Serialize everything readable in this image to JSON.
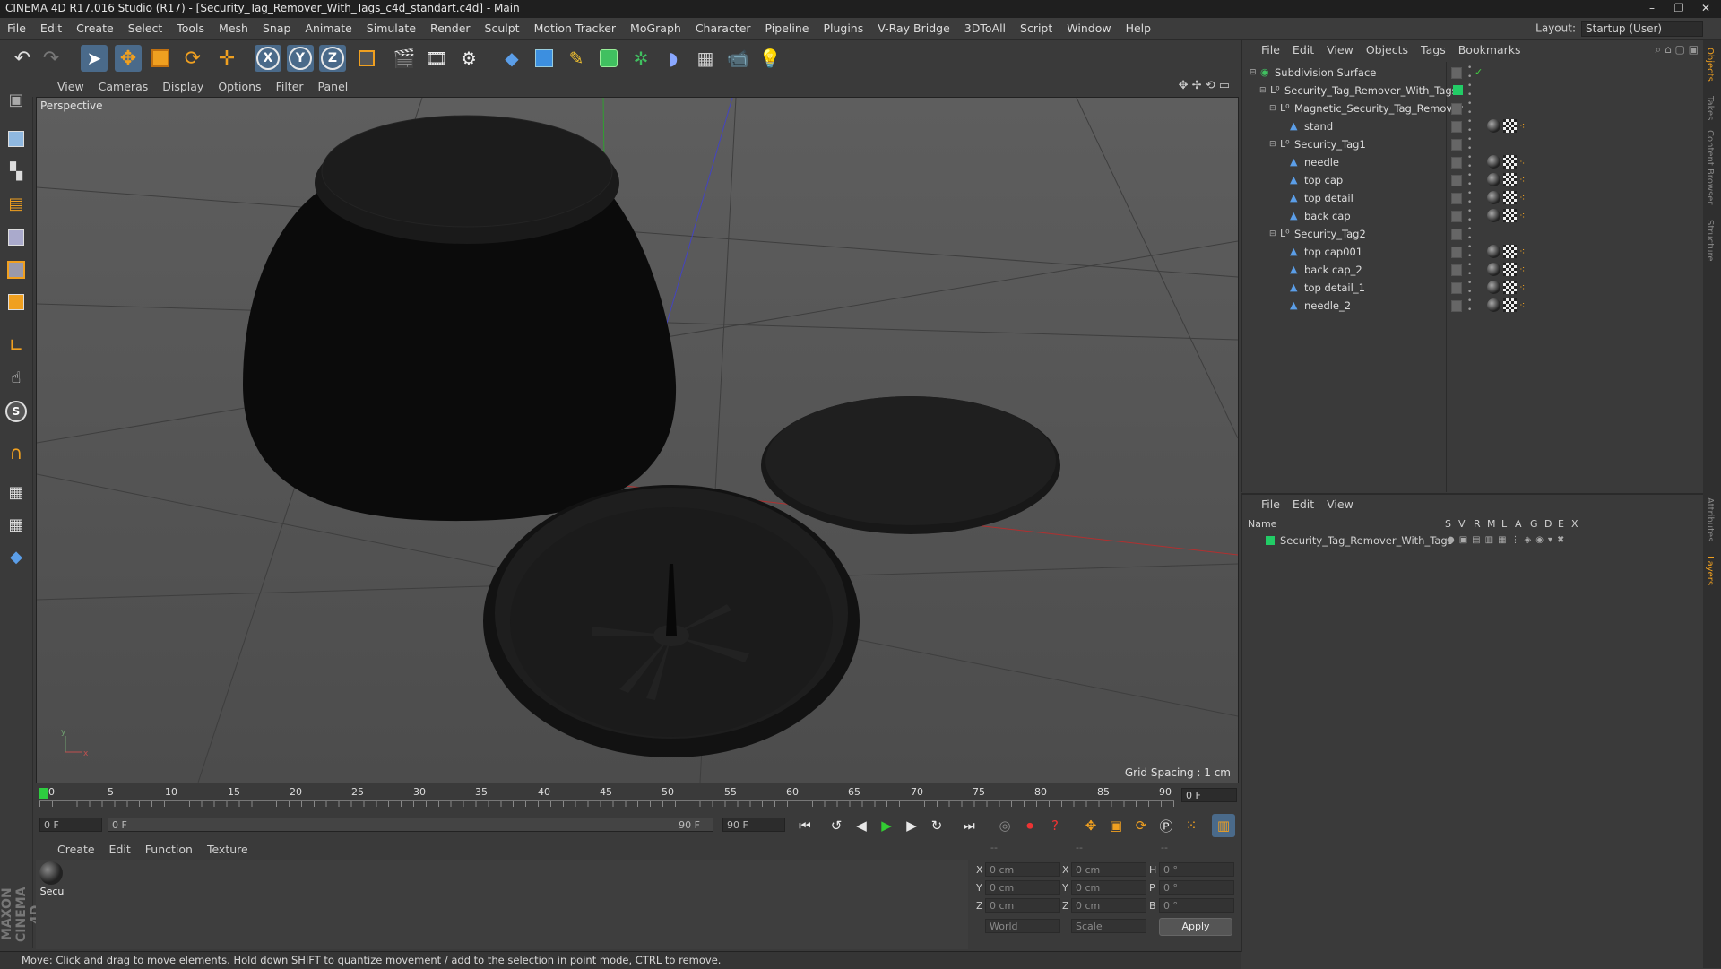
{
  "window": {
    "title": "CINEMA 4D R17.016 Studio (R17) - [Security_Tag_Remover_With_Tags_c4d_standart.c4d] - Main",
    "controls": [
      "–",
      "❐",
      "✕"
    ]
  },
  "menubar": {
    "items": [
      "File",
      "Edit",
      "Create",
      "Select",
      "Tools",
      "Mesh",
      "Snap",
      "Animate",
      "Simulate",
      "Render",
      "Sculpt",
      "Motion Tracker",
      "MoGraph",
      "Character",
      "Pipeline",
      "Plugins",
      "V-Ray Bridge",
      "3DToAll",
      "Script",
      "Window",
      "Help"
    ],
    "layout_label": "Layout:",
    "layout_value": "Startup (User)"
  },
  "viewport": {
    "menu": [
      "View",
      "Cameras",
      "Display",
      "Options",
      "Filter",
      "Panel"
    ],
    "camera_label": "Perspective",
    "grid_spacing": "Grid Spacing : 1 cm"
  },
  "timeline": {
    "ticks": [
      "0",
      "5",
      "10",
      "15",
      "20",
      "25",
      "30",
      "35",
      "40",
      "45",
      "50",
      "55",
      "60",
      "65",
      "70",
      "75",
      "80",
      "85",
      "90"
    ],
    "current_frame": "0 F",
    "start_field": "0 F",
    "range_start": "0 F",
    "range_end": "90 F",
    "end_field": "90 F"
  },
  "material_manager": {
    "menu": [
      "Create",
      "Edit",
      "Function",
      "Texture"
    ],
    "materials": [
      {
        "label": "Secu"
      }
    ]
  },
  "coordinates": {
    "header": [
      "--",
      "--",
      "--"
    ],
    "rows": [
      {
        "a": "X",
        "av": "0 cm",
        "b": "X",
        "bv": "0 cm",
        "c": "H",
        "cv": "0 °"
      },
      {
        "a": "Y",
        "av": "0 cm",
        "b": "Y",
        "bv": "0 cm",
        "c": "P",
        "cv": "0 °"
      },
      {
        "a": "Z",
        "av": "0 cm",
        "b": "Z",
        "bv": "0 cm",
        "c": "B",
        "cv": "0 °"
      }
    ],
    "space": "World",
    "mode": "Scale",
    "apply": "Apply"
  },
  "status": "Move: Click and drag to move elements. Hold down SHIFT to quantize movement / add to the selection in point mode, CTRL to remove.",
  "object_manager": {
    "menu": [
      "File",
      "Edit",
      "View",
      "Objects",
      "Tags",
      "Bookmarks"
    ],
    "objects": [
      {
        "name": "Subdivision Surface",
        "depth": 0,
        "type": "subdiv",
        "tags": false,
        "check": true
      },
      {
        "name": "Security_Tag_Remover_With_Tags",
        "depth": 1,
        "type": "null",
        "tags": false,
        "layer": true
      },
      {
        "name": "Magnetic_Security_Tag_Remover",
        "depth": 2,
        "type": "null",
        "tags": false
      },
      {
        "name": "stand",
        "depth": 3,
        "type": "poly",
        "tags": true
      },
      {
        "name": "Security_Tag1",
        "depth": 2,
        "type": "null",
        "tags": false
      },
      {
        "name": "needle",
        "depth": 3,
        "type": "poly",
        "tags": true
      },
      {
        "name": "top cap",
        "depth": 3,
        "type": "poly",
        "tags": true
      },
      {
        "name": "top detail",
        "depth": 3,
        "type": "poly",
        "tags": true
      },
      {
        "name": "back cap",
        "depth": 3,
        "type": "poly",
        "tags": true
      },
      {
        "name": "Security_Tag2",
        "depth": 2,
        "type": "null",
        "tags": false
      },
      {
        "name": "top cap001",
        "depth": 3,
        "type": "poly",
        "tags": true
      },
      {
        "name": "back cap_2",
        "depth": 3,
        "type": "poly",
        "tags": true
      },
      {
        "name": "top detail_1",
        "depth": 3,
        "type": "poly",
        "tags": true
      },
      {
        "name": "needle_2",
        "depth": 3,
        "type": "poly",
        "tags": true
      }
    ]
  },
  "layer_manager": {
    "menu": [
      "File",
      "Edit",
      "View"
    ],
    "columns": [
      "Name",
      "S",
      "V",
      "R",
      "M",
      "L",
      "A",
      "G",
      "D",
      "E",
      "X"
    ],
    "layers": [
      {
        "name": "Security_Tag_Remover_With_Tags",
        "color": "#22cc66"
      }
    ]
  },
  "side_tabs": [
    "Objects",
    "Takes",
    "Content Browser",
    "Structure",
    "Attributes",
    "Layers"
  ],
  "colors": {
    "accent": "#4a6a8a",
    "layer_green": "#22cc66",
    "x_axis": "#e04040",
    "y_axis": "#40c040",
    "z_axis": "#5050d0"
  }
}
